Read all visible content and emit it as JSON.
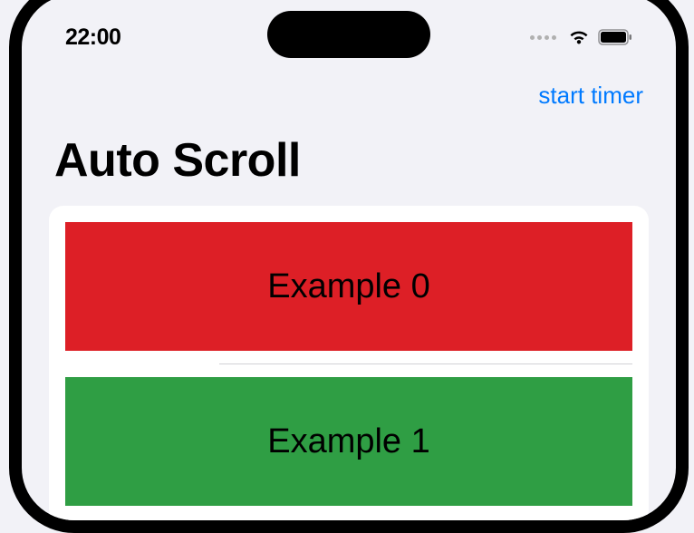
{
  "status": {
    "time": "22:00"
  },
  "nav": {
    "action_label": "start timer"
  },
  "title": "Auto Scroll",
  "list": {
    "items": [
      {
        "label": "Example 0",
        "color": "red"
      },
      {
        "label": "Example 1",
        "color": "green"
      }
    ]
  }
}
